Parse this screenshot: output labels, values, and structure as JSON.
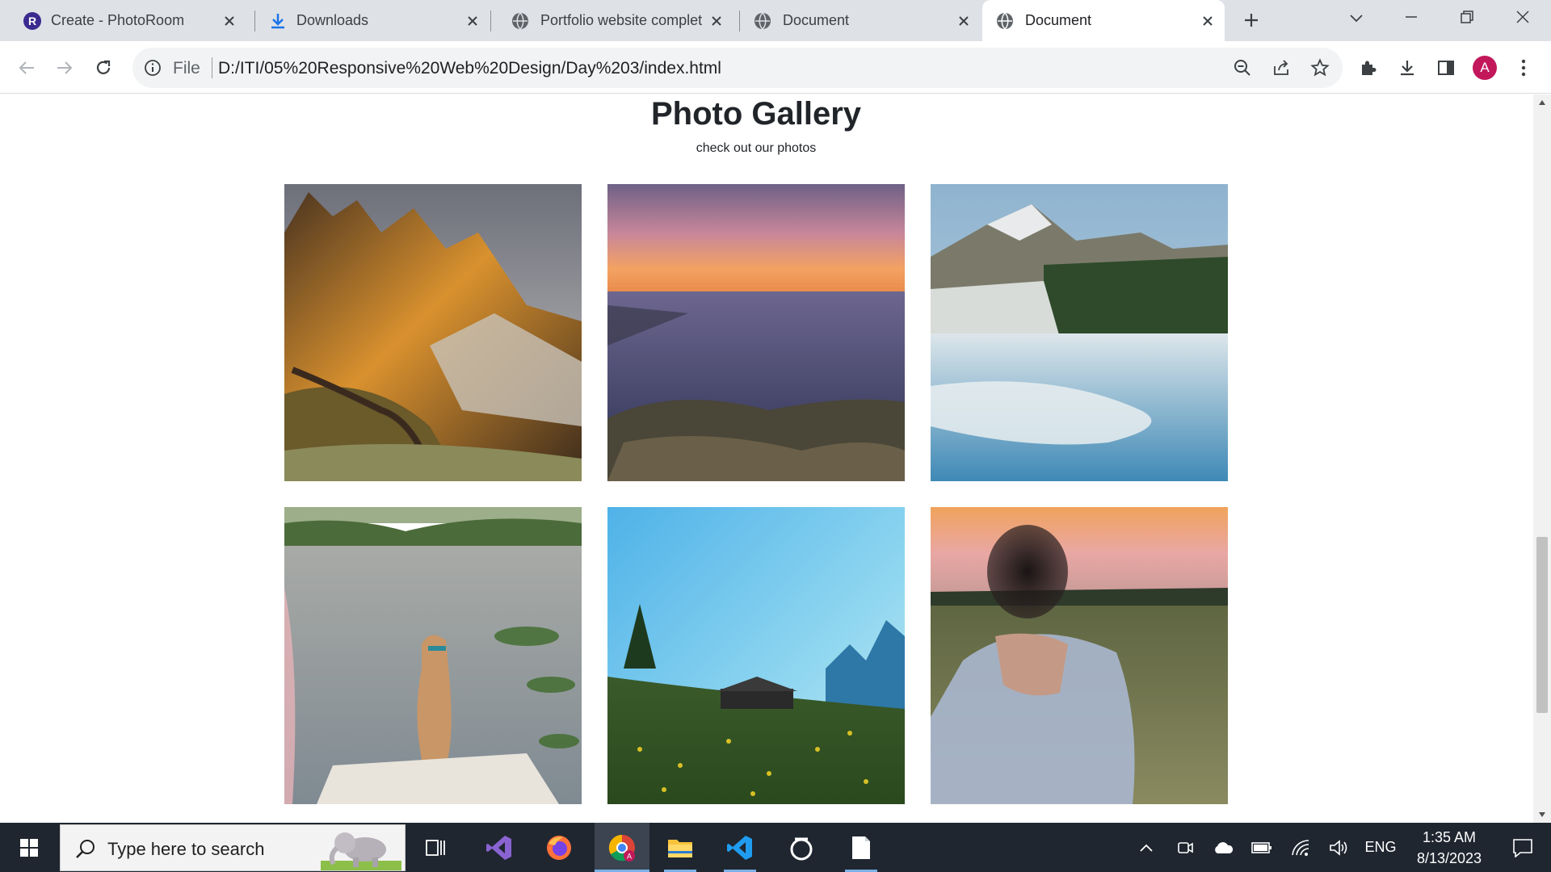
{
  "browser": {
    "tabs": [
      {
        "title": "Create - PhotoRoom",
        "icon": "photoroom-icon"
      },
      {
        "title": "Downloads",
        "icon": "download-icon"
      },
      {
        "title": "Portfolio website complet",
        "icon": "globe-icon"
      },
      {
        "title": "Document",
        "icon": "globe-icon"
      },
      {
        "title": "Document",
        "icon": "globe-icon",
        "active": true
      }
    ],
    "omnibox": {
      "scheme_label": "File",
      "url": "D:/ITI/05%20Responsive%20Web%20Design/Day%203/index.html"
    },
    "profile_initial": "A"
  },
  "page": {
    "title": "Photo Gallery",
    "subtitle": "check out our photos",
    "photos": [
      {
        "alt": "mountain-sunset"
      },
      {
        "alt": "sea-sunset"
      },
      {
        "alt": "snowy-lake"
      },
      {
        "alt": "dog-lake"
      },
      {
        "alt": "meadow-cabin"
      },
      {
        "alt": "field-sunset"
      }
    ]
  },
  "taskbar": {
    "search_placeholder": "Type here to search",
    "language": "ENG",
    "time": "1:35 AM",
    "date": "8/13/2023"
  },
  "colors": {
    "tabstrip": "#dee1e6",
    "taskbar": "#1f2630",
    "profile": "#c2185b"
  }
}
